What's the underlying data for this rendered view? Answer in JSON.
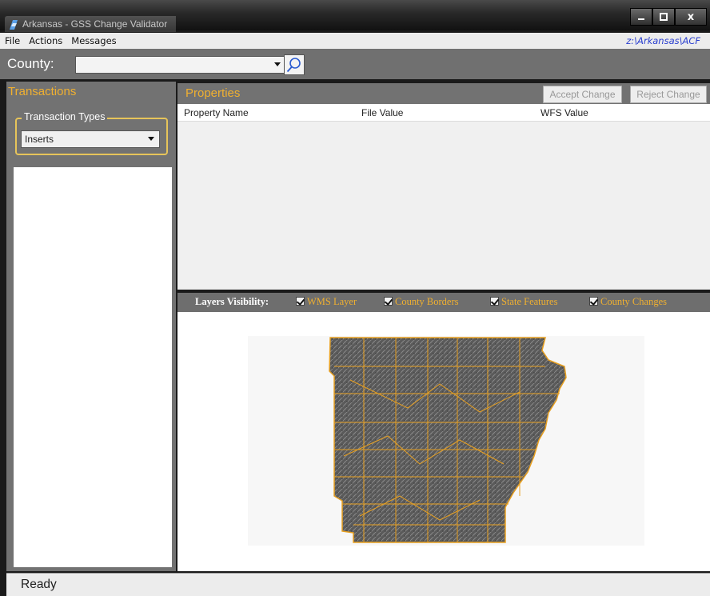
{
  "window": {
    "title": "Arkansas - GSS Change Validator",
    "buttons": [
      "minimize",
      "maximize",
      "close"
    ],
    "close_glyph": "x"
  },
  "menu": {
    "items": [
      "File",
      "Actions",
      "Messages"
    ],
    "path": "z:\\Arkansas\\ACF"
  },
  "county": {
    "label": "County:",
    "value": "",
    "search_icon": "search-icon"
  },
  "transactions": {
    "header": "Transactions",
    "types_legend": "Transaction Types",
    "selected_type": "Inserts",
    "items": []
  },
  "properties": {
    "header": "Properties",
    "accept_label": "Accept Change",
    "reject_label": "Reject Change",
    "columns": [
      "Property Name",
      "File Value",
      "WFS Value"
    ],
    "rows": []
  },
  "layers": {
    "label": "Layers Visibility:",
    "items": [
      {
        "label": "WMS Layer",
        "checked": true
      },
      {
        "label": "County Borders",
        "checked": true
      },
      {
        "label": "State Features",
        "checked": true
      },
      {
        "label": "County Changes",
        "checked": true
      }
    ]
  },
  "map": {
    "subject": "Arkansas county map",
    "border_color": "#e8a020",
    "fill_color": "#5c5c5c"
  },
  "status": {
    "text": "Ready"
  },
  "colors": {
    "accent": "#f0b030",
    "panel": "#727272",
    "path_link": "#2a3fd0"
  }
}
